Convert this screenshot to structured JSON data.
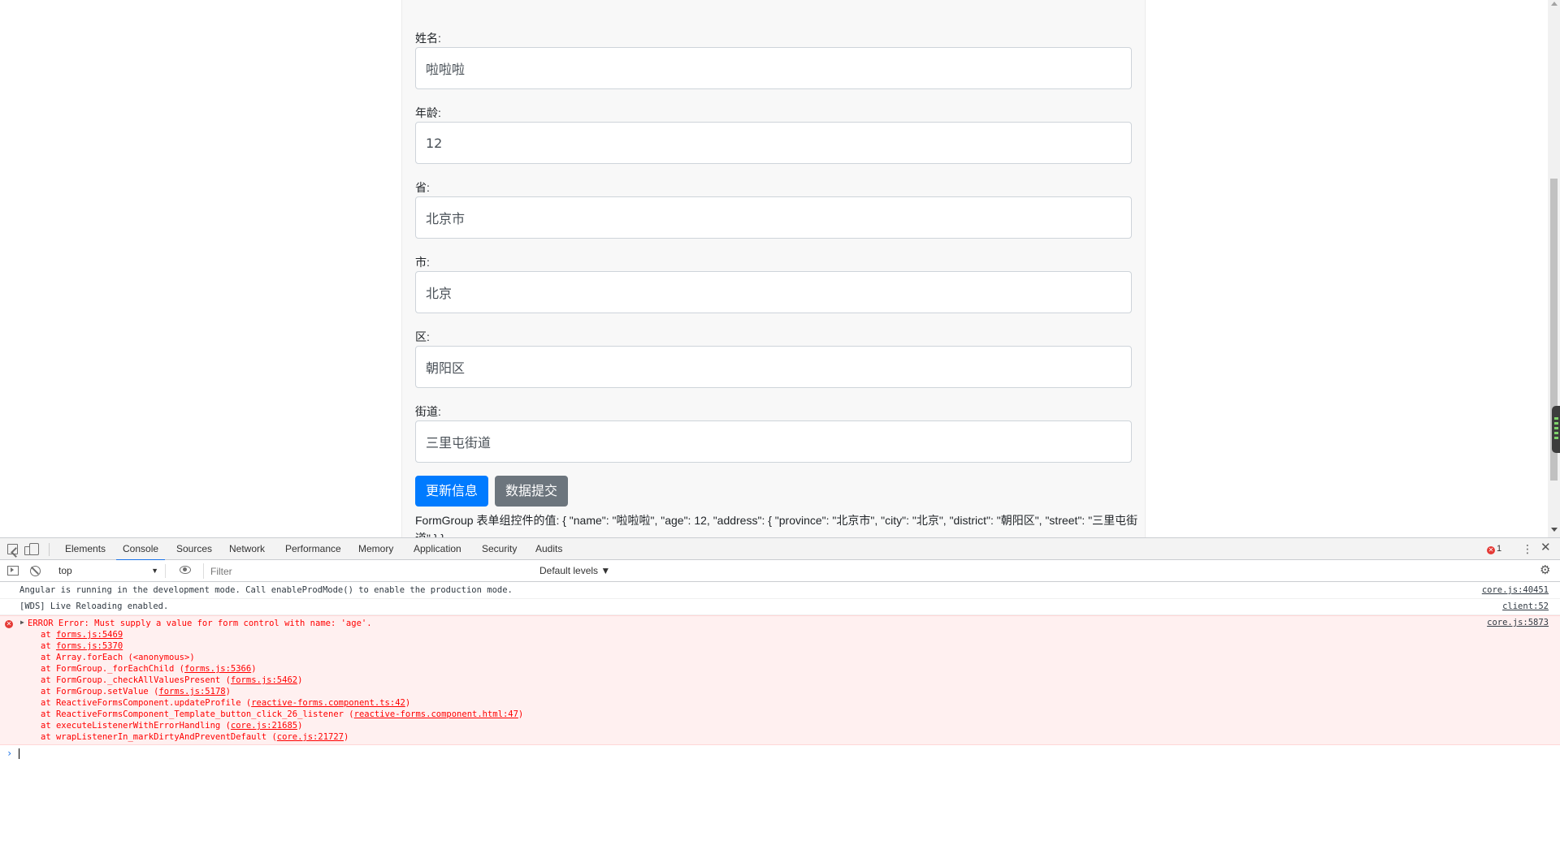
{
  "form": {
    "fields": [
      {
        "label": "姓名:",
        "value": "啦啦啦"
      },
      {
        "label": "年龄:",
        "value": "12"
      },
      {
        "label": "省:",
        "value": "北京市"
      },
      {
        "label": "市:",
        "value": "北京"
      },
      {
        "label": "区:",
        "value": "朝阳区"
      },
      {
        "label": "街道:",
        "value": "三里屯街道"
      }
    ],
    "update_button": "更新信息",
    "submit_button": "数据提交",
    "output": "FormGroup 表单组控件的值: { \"name\": \"啦啦啦\", \"age\": 12, \"address\": { \"province\": \"北京市\", \"city\": \"北京\", \"district\": \"朝阳区\", \"street\": \"三里屯街道\" } }"
  },
  "devtools": {
    "tabs": [
      "Elements",
      "Console",
      "Sources",
      "Network",
      "Performance",
      "Memory",
      "Application",
      "Security",
      "Audits"
    ],
    "active_tab": "Console",
    "error_count": "1",
    "context": "top",
    "filter_placeholder": "Filter",
    "levels": "Default levels ▼",
    "messages": [
      {
        "text": "Angular is running in the development mode. Call enableProdMode() to enable the production mode.",
        "source": "core.js:40451"
      },
      {
        "text": "[WDS] Live Reloading enabled.",
        "source": "client:52"
      }
    ],
    "error": {
      "head": "ERROR Error: Must supply a value for form control with name: 'age'.",
      "source": "core.js:5873",
      "stack": [
        {
          "pre": "at ",
          "link": "forms.js:5469",
          "post": ""
        },
        {
          "pre": "at ",
          "link": "forms.js:5370",
          "post": ""
        },
        {
          "pre": "at Array.forEach (<anonymous>)",
          "link": "",
          "post": ""
        },
        {
          "pre": "at FormGroup._forEachChild (",
          "link": "forms.js:5366",
          "post": ")"
        },
        {
          "pre": "at FormGroup._checkAllValuesPresent (",
          "link": "forms.js:5462",
          "post": ")"
        },
        {
          "pre": "at FormGroup.setValue (",
          "link": "forms.js:5178",
          "post": ")"
        },
        {
          "pre": "at ReactiveFormsComponent.updateProfile (",
          "link": "reactive-forms.component.ts:42",
          "post": ")"
        },
        {
          "pre": "at ReactiveFormsComponent_Template_button_click_26_listener (",
          "link": "reactive-forms.component.html:47",
          "post": ")"
        },
        {
          "pre": "at executeListenerWithErrorHandling (",
          "link": "core.js:21685",
          "post": ")"
        },
        {
          "pre": "at wrapListenerIn_markDirtyAndPreventDefault (",
          "link": "core.js:21727",
          "post": ")"
        }
      ]
    }
  }
}
